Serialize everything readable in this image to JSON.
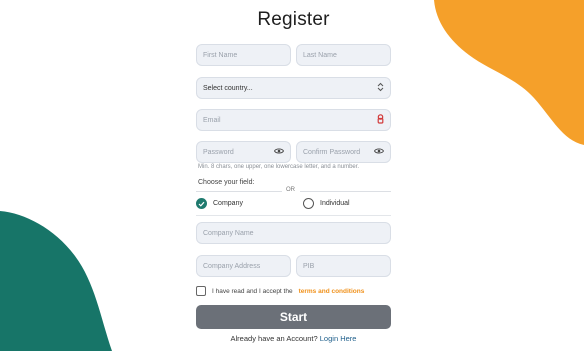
{
  "colors": {
    "orange_blob": "#f5a02a",
    "teal_blob": "#177568",
    "accent_orange": "#f0911b",
    "button_gray": "#6b7078",
    "radio_teal": "#1f7a6e"
  },
  "title": "Register",
  "fields": {
    "first_name_placeholder": "First Name",
    "last_name_placeholder": "Last Name",
    "country_value": "Select country...",
    "email_placeholder": "Email",
    "password_placeholder": "Password",
    "confirm_password_placeholder": "Confirm Password",
    "company_name_placeholder": "Company Name",
    "company_address_placeholder": "Company Address",
    "pib_placeholder": "PIB"
  },
  "password_hint": "Min. 8 chars, one upper, one lowercase letter, and a number.",
  "choose_label": "Choose your field:",
  "or_label": "OR",
  "radio": {
    "company_label": "Company",
    "individual_label": "Individual",
    "selected": "Company"
  },
  "terms": {
    "text": "I have read and I accept the",
    "link": "terms and conditions"
  },
  "start_label": "Start",
  "login": {
    "text": "Already have an Account?",
    "link": "Login Here"
  },
  "icons": {
    "country": "chevron-updown-icon",
    "email": "password-manager-icon",
    "password": "eye-icon",
    "confirm": "eye-icon",
    "radio_checked": "check-icon"
  }
}
